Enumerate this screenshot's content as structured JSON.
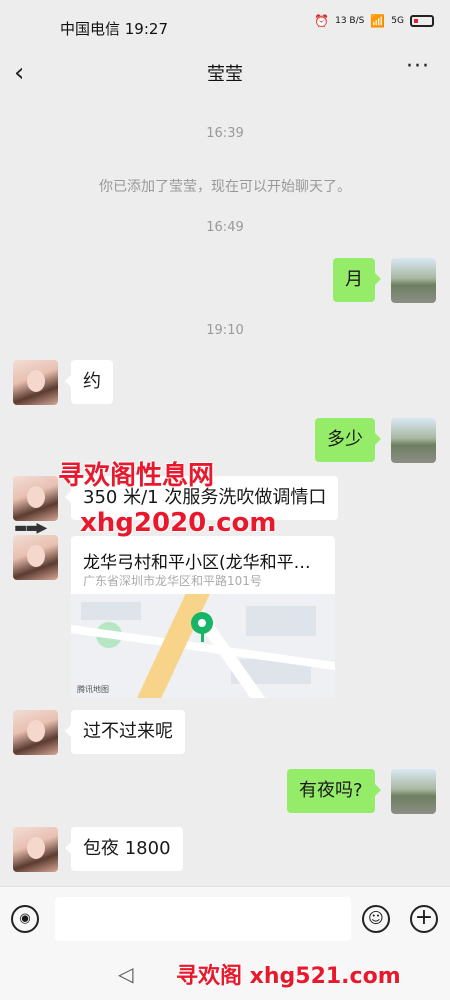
{
  "status_bar": {
    "carrier_time": "中国电信 19:27",
    "net_speed": "13 B/S",
    "network": "5G"
  },
  "header": {
    "back_icon": "chevron-left-icon",
    "title": "莹莹",
    "more_icon": "more-dots-icon"
  },
  "messages": {
    "ts1": "16:39",
    "system": "你已添加了莹莹，现在可以开始聊天了。",
    "ts2": "16:49",
    "m1": "月",
    "ts3": "19:10",
    "m2": "约",
    "m3": "多少",
    "m4": "350 米/1 次服务洗吹做调情口",
    "location": {
      "name": "龙华弓村和平小区(龙华和平…",
      "address": "广东省深圳市龙华区和平路101号",
      "map_logo": "腾讯地图"
    },
    "m5": "过不过来呢",
    "m6": "有夜吗?",
    "m7": "包夜 1800"
  },
  "watermarks": {
    "w1": "寻欢阁性息网",
    "w2": "xhg2020.com",
    "w3": "寻欢阁 xhg521.com"
  },
  "input_bar": {
    "voice_icon": "voice-icon",
    "emoji_icon": "emoji-icon",
    "plus_icon": "plus-icon"
  },
  "colors": {
    "background": "#ededed",
    "sent_bubble": "#95ec69",
    "received_bubble": "#ffffff",
    "watermark": "#e8192c"
  }
}
